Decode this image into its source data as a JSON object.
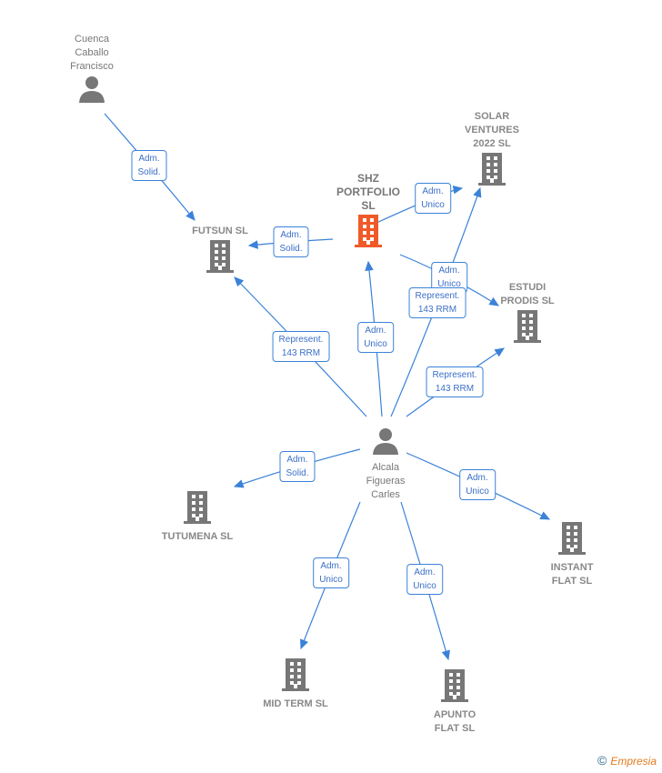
{
  "colors": {
    "edge": "#3b82d8",
    "company": "#777777",
    "highlight": "#f05a28",
    "person": "#777777"
  },
  "nodes": [
    {
      "id": "cuenca",
      "type": "person",
      "label": "Cuenca\nCaballo\nFrancisco"
    },
    {
      "id": "futsun",
      "type": "company",
      "label": "FUTSUN SL"
    },
    {
      "id": "shz",
      "type": "company",
      "highlight": true,
      "label": "SHZ\nPORTFOLIO\nSL"
    },
    {
      "id": "solar",
      "type": "company",
      "label": "SOLAR\nVENTURES\n2022 SL"
    },
    {
      "id": "estudi",
      "type": "company",
      "label": "ESTUDI\nPRODIS SL"
    },
    {
      "id": "alcala",
      "type": "person",
      "label": "Alcala\nFigueras\nCarles"
    },
    {
      "id": "tutumena",
      "type": "company",
      "label": "TUTUMENA SL"
    },
    {
      "id": "instant",
      "type": "company",
      "label": "INSTANT\nFLAT SL"
    },
    {
      "id": "midterm",
      "type": "company",
      "label": "MID TERM SL"
    },
    {
      "id": "apunto",
      "type": "company",
      "label": "APUNTO\nFLAT SL"
    }
  ],
  "edges": [
    {
      "from": "cuenca",
      "to": "futsun",
      "label": "Adm.\nSolid."
    },
    {
      "from": "shz",
      "to": "futsun",
      "label": "Adm.\nSolid."
    },
    {
      "from": "shz",
      "to": "solar",
      "label": "Adm.\nUnico"
    },
    {
      "from": "shz",
      "to": "estudi",
      "label": "Adm.\nUnico"
    },
    {
      "from": "alcala",
      "to": "solar",
      "label": "Represent.\n143 RRM"
    },
    {
      "from": "alcala",
      "to": "futsun",
      "label": "Represent.\n143 RRM"
    },
    {
      "from": "alcala",
      "to": "shz",
      "label": "Adm.\nUnico"
    },
    {
      "from": "alcala",
      "to": "estudi",
      "label": "Represent.\n143 RRM"
    },
    {
      "from": "alcala",
      "to": "tutumena",
      "label": "Adm.\nSolid."
    },
    {
      "from": "alcala",
      "to": "instant",
      "label": "Adm.\nUnico"
    },
    {
      "from": "alcala",
      "to": "midterm",
      "label": "Adm.\nUnico"
    },
    {
      "from": "alcala",
      "to": "apunto",
      "label": "Adm.\nUnico"
    }
  ],
  "footer": {
    "copyright": "©",
    "brand": "Empresia"
  }
}
